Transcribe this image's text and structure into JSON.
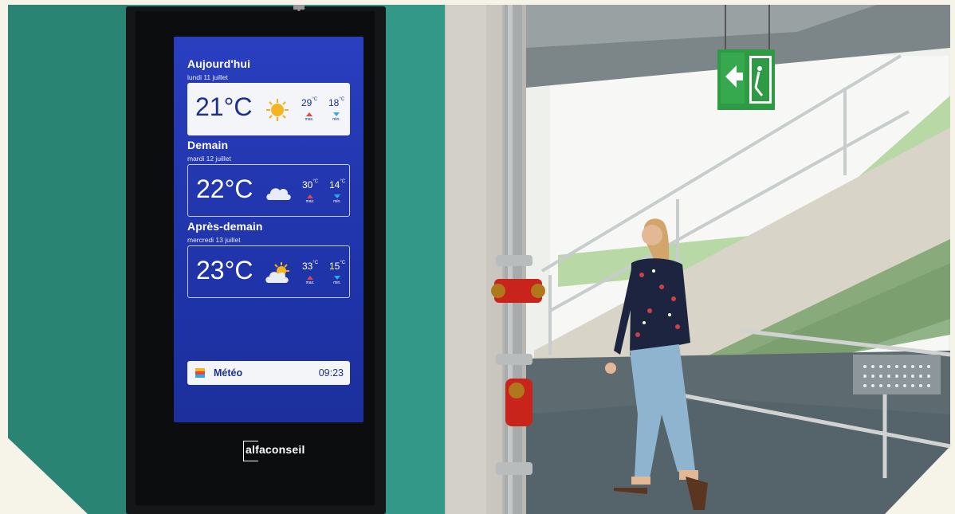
{
  "screen": {
    "days": [
      {
        "title": "Aujourd'hui",
        "date": "lundi 11 juillet",
        "temp": "21°C",
        "weather_icon": "sun-icon",
        "max": "29",
        "min": "18",
        "max_label": "max.",
        "min_label": "min."
      },
      {
        "title": "Demain",
        "date": "mardi 12 juillet",
        "temp": "22°C",
        "weather_icon": "cloud-icon",
        "max": "30",
        "min": "14",
        "max_label": "max.",
        "min_label": "min."
      },
      {
        "title": "Après-demain",
        "date": "mercredi 13 juillet",
        "temp": "23°C",
        "weather_icon": "partly-cloudy-icon",
        "max": "33",
        "min": "15",
        "max_label": "max.",
        "min_label": "min."
      }
    ],
    "footer": {
      "app_name": "Météo",
      "time": "09:23"
    }
  },
  "brand": "alfaconseil",
  "colors": {
    "screen_blue": "#2337b0",
    "wall_teal": "#2f8f80",
    "card_bg": "#f3f5f8",
    "exit_sign_green": "#2e9a44",
    "hydrant_red": "#c8241c"
  }
}
